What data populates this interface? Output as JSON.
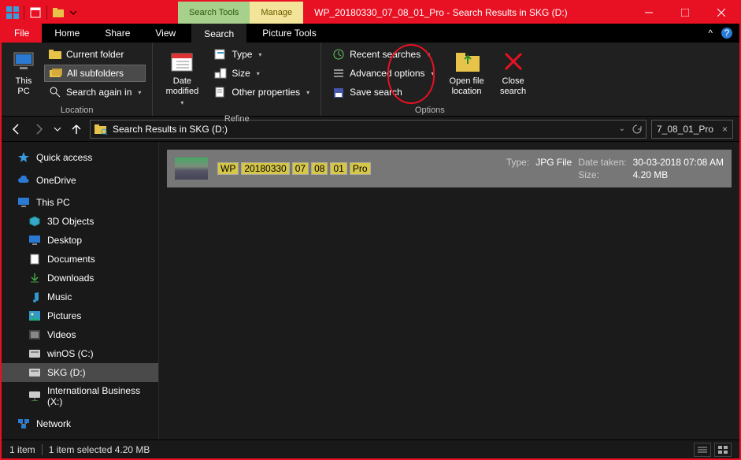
{
  "titlebar": {
    "context_tabs": [
      {
        "label": "Search Tools"
      },
      {
        "label": "Manage"
      }
    ],
    "title": "WP_20180330_07_08_01_Pro - Search Results in SKG (D:)"
  },
  "menubar": {
    "file": "File",
    "tabs": [
      "Home",
      "Share",
      "View"
    ],
    "search_tab": "Search",
    "picture_tab": "Picture Tools"
  },
  "ribbon": {
    "location": {
      "label": "Location",
      "this_pc": "This\nPC",
      "current_folder": "Current folder",
      "all_subfolders": "All subfolders",
      "search_again": "Search again in"
    },
    "refine": {
      "label": "Refine",
      "date_modified": "Date\nmodified",
      "type": "Type",
      "size": "Size",
      "other_props": "Other properties"
    },
    "options": {
      "label": "Options",
      "recent": "Recent searches",
      "advanced": "Advanced options",
      "save": "Save search",
      "open_loc": "Open file\nlocation",
      "close": "Close\nsearch"
    }
  },
  "navbar": {
    "breadcrumb": "Search Results in SKG (D:)",
    "search_value": "7_08_01_Pro"
  },
  "sidebar": {
    "quick": "Quick access",
    "onedrive": "OneDrive",
    "this_pc": "This PC",
    "children": [
      "3D Objects",
      "Desktop",
      "Documents",
      "Downloads",
      "Music",
      "Pictures",
      "Videos",
      "winOS (C:)",
      "SKG (D:)",
      "International Business (X:)"
    ],
    "network": "Network"
  },
  "result": {
    "name_parts": [
      "WP",
      "20180330",
      "07",
      "08",
      "01",
      "Pro"
    ],
    "type_k": "Type:",
    "type_v": "JPG File",
    "date_k": "Date taken:",
    "date_v": "30-03-2018 07:08 AM",
    "size_k": "Size:",
    "size_v": "4.20 MB"
  },
  "status": {
    "count": "1 item",
    "selected": "1 item selected  4.20 MB"
  }
}
